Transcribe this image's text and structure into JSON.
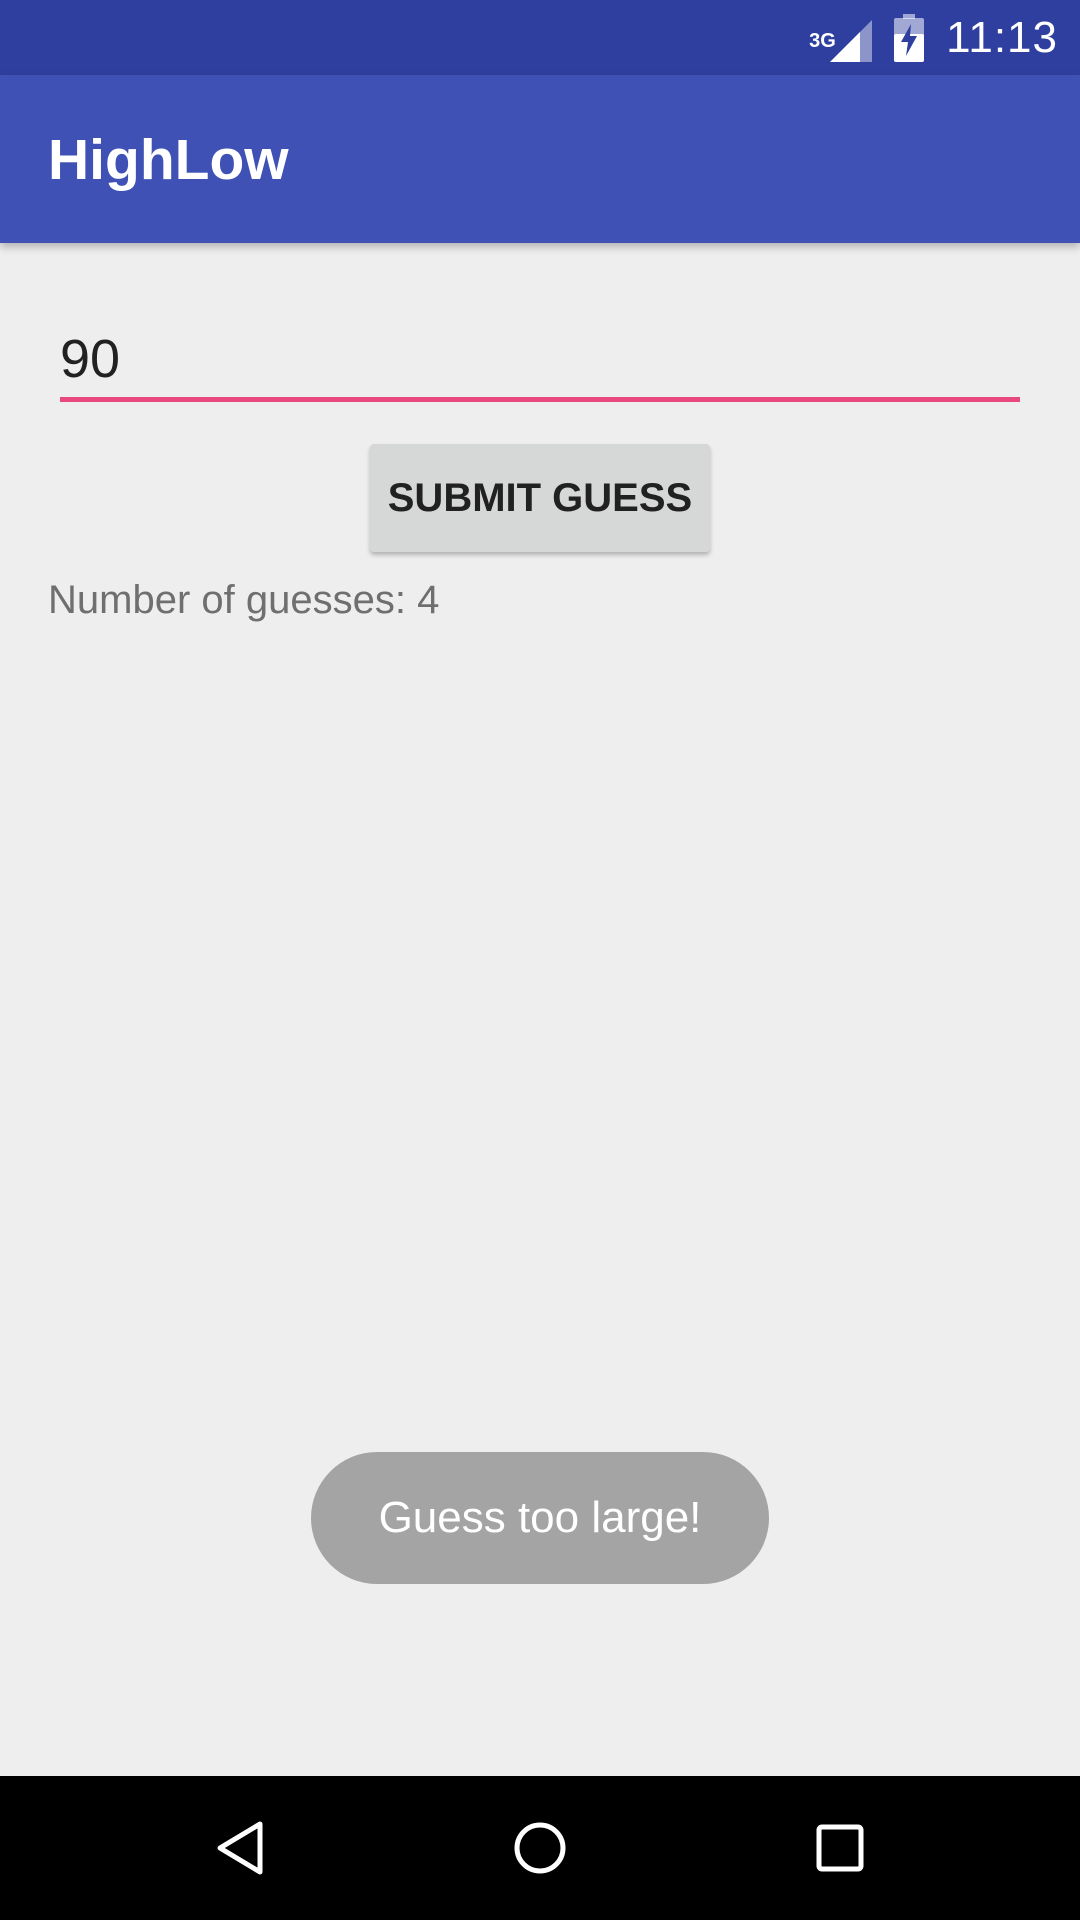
{
  "status_bar": {
    "network_type": "3G",
    "time": "11:13",
    "icons": [
      "signal-icon",
      "battery-charging-icon"
    ]
  },
  "app_bar": {
    "title": "HighLow"
  },
  "main": {
    "guess_input_value": "90",
    "submit_button_label": "SUBMIT GUESS",
    "guess_count_text": "Number of guesses: 4"
  },
  "toast": {
    "message": "Guess too large!"
  },
  "nav_bar": {
    "icons": [
      "back-icon",
      "home-icon",
      "recents-icon"
    ]
  },
  "colors": {
    "status_bar": "#2f3f9f",
    "app_bar": "#3f51b5",
    "accent": "#e94780",
    "background": "#eeeeee",
    "button": "#d6d7d7",
    "toast": "#a4a4a4"
  }
}
